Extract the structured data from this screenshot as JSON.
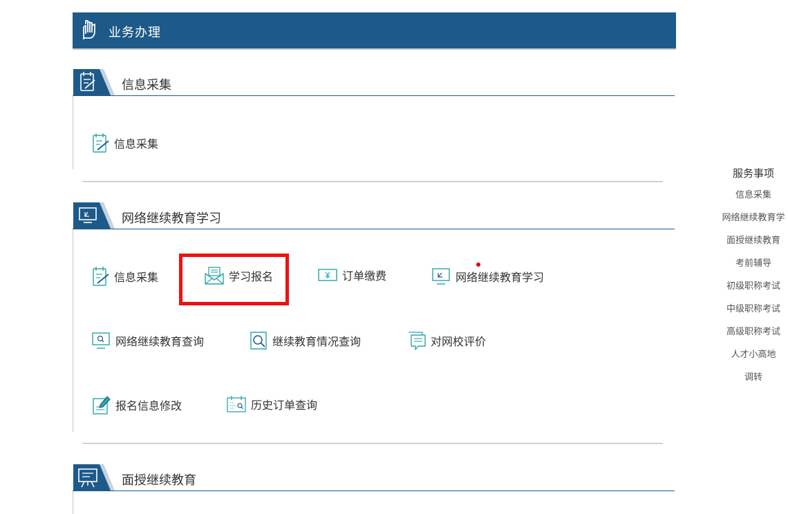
{
  "header": {
    "title": "业务办理",
    "icon": "hand-icon"
  },
  "sections": [
    {
      "title": "信息采集",
      "icon": "notepad-icon",
      "items": [
        {
          "label": "信息采集",
          "icon": "form-pen-icon"
        }
      ]
    },
    {
      "title": "网络继续教育学习",
      "icon": "monitor-icon",
      "items": [
        {
          "label": "信息采集",
          "icon": "form-pen-icon"
        },
        {
          "label": "学习报名",
          "icon": "envelope-icon"
        },
        {
          "label": "订单缴费",
          "icon": "yen-card-icon"
        },
        {
          "label": "网络继续教育学习",
          "icon": "monitor-icon"
        },
        {
          "label": "网络继续教育查询",
          "icon": "monitor-search-icon"
        },
        {
          "label": "继续教育情况查询",
          "icon": "search-doc-icon"
        },
        {
          "label": "对网校评价",
          "icon": "comment-icon"
        },
        {
          "label": "报名信息修改",
          "icon": "edit-doc-icon"
        },
        {
          "label": "历史订单查询",
          "icon": "calendar-search-icon"
        }
      ]
    },
    {
      "title": "面授继续教育",
      "icon": "presentation-icon",
      "items": []
    }
  ],
  "sidebar": {
    "title": "服务事项",
    "items": [
      "信息采集",
      "网络继续教育学",
      "面授继续教育",
      "考前辅导",
      "初级职称考试",
      "中级职称考试",
      "高级职称考试",
      "人才小高地",
      "调转"
    ]
  },
  "colors": {
    "primary": "#1d5a8a",
    "icon_teal": "#2aa6a6",
    "highlight": "#f01010"
  }
}
